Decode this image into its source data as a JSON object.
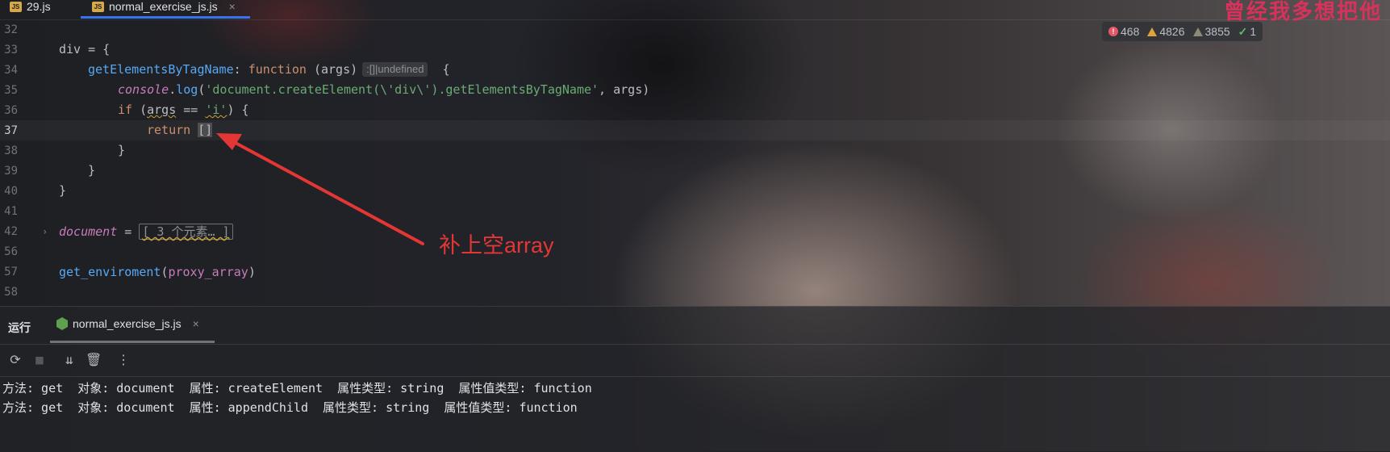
{
  "tabs": [
    {
      "label": "29.js",
      "icon": "js-file-icon",
      "active": false
    },
    {
      "label": "normal_exercise_js.js",
      "icon": "js-file-icon",
      "active": true
    }
  ],
  "tab_close_glyph": "×",
  "background_art_text": "曾经我多想把他",
  "inspections": {
    "errors": "468",
    "warnings": "4826",
    "weak_warnings": "3855",
    "ok": "1"
  },
  "editor": {
    "line_numbers": [
      "32",
      "33",
      "34",
      "35",
      "36",
      "37",
      "38",
      "39",
      "40",
      "41",
      "42",
      "56",
      "57",
      "58"
    ],
    "current_line": "37",
    "code": {
      "l33_var": "div",
      "l33_rest": " = {",
      "l34_prop": "getElementsByTagName",
      "l34_colon": ": ",
      "l34_kw": "function",
      "l34_args": " (args)",
      "l34_hint": ":[]|undefined",
      "l34_brace": "  {",
      "l35_obj": "console",
      "l35_dot": ".",
      "l35_fn": "log",
      "l35_open": "(",
      "l35_str": "'document.createElement(\\'div\\').getElementsByTagName'",
      "l35_rest": ", args)",
      "l36_kw": "if",
      "l36_open": " (",
      "l36_var": "args",
      "l36_op": " == ",
      "l36_str": "'i'",
      "l36_close": ") {",
      "l37_kw": "return",
      "l37_sp": " ",
      "l37_val": "[]",
      "l38": "}",
      "l39": "}",
      "l40": "}",
      "l42_var": "document",
      "l42_eq": " = ",
      "l42_folded": "[ 3 个元素… ]",
      "l57_fn": "get_enviroment",
      "l57_open": "(",
      "l57_arg": "proxy_array",
      "l57_close": ")"
    }
  },
  "annotation": {
    "text": "补上空array",
    "color": "#e53636"
  },
  "run_panel": {
    "title": "运行",
    "tab_label": "normal_exercise_js.js",
    "tab_close": "×",
    "console_lines": [
      "方法: get  对象: document  属性: createElement  属性类型: string  属性值类型: function",
      "方法: get  对象: document  属性: appendChild  属性类型: string  属性值类型: function"
    ]
  },
  "colors": {
    "accent": "#3574f0",
    "keyword": "#cf8e6d",
    "string": "#6aab73",
    "property": "#56a8f5",
    "global": "#c77dbb"
  }
}
